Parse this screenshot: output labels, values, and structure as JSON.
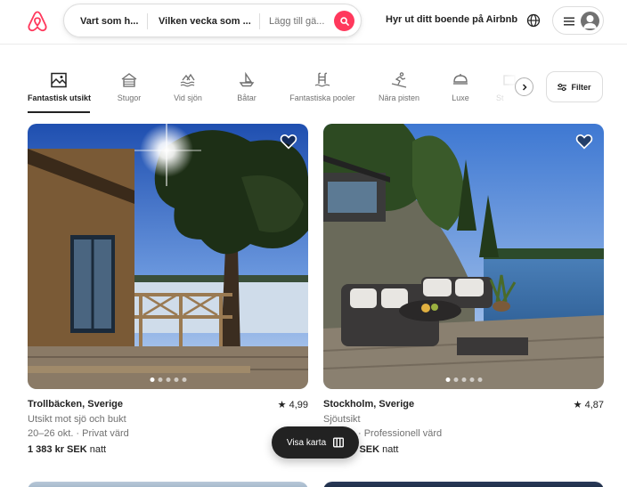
{
  "header": {
    "logo_icon": "airbnb-logo-icon",
    "search": {
      "where": "Vart som h...",
      "when": "Vilken vecka som ...",
      "who": "Lägg till gä...",
      "button_icon": "search-icon"
    },
    "host_link": "Hyr ut ditt boende på Airbnb",
    "globe_icon": "globe-icon",
    "menu_icon": "hamburger-icon",
    "avatar_icon": "user-avatar-icon"
  },
  "categories": {
    "items": [
      {
        "label": "Fantastisk utsikt",
        "icon": "view-icon",
        "active": true
      },
      {
        "label": "Stugor",
        "icon": "cabin-icon",
        "active": false
      },
      {
        "label": "Vid sjön",
        "icon": "lake-icon",
        "active": false
      },
      {
        "label": "Båtar",
        "icon": "boat-icon",
        "active": false
      },
      {
        "label": "Fantastiska pooler",
        "icon": "pool-icon",
        "active": false
      },
      {
        "label": "Nära pisten",
        "icon": "ski-icon",
        "active": false
      },
      {
        "label": "Luxe",
        "icon": "luxe-icon",
        "active": false
      },
      {
        "label": "St",
        "icon": "more-icon",
        "active": false
      }
    ],
    "next_icon": "chevron-right-icon",
    "filter_label": "Filter",
    "filter_icon": "sliders-icon"
  },
  "listings": [
    {
      "title": "Trollbäcken, Sverige",
      "rating": "4,99",
      "subtitle": "Utsikt mot sjö och bukt",
      "details": "20–26 okt. · Privat värd",
      "price": "1 383 kr SEK",
      "price_unit": "natt"
    },
    {
      "title": "Stockholm, Sverige",
      "rating": "4,87",
      "subtitle": "Sjöutsikt",
      "details": "· Professionell värd",
      "price": "kr SEK",
      "price_unit": "natt"
    }
  ],
  "map_button": {
    "label": "Visa karta",
    "icon": "map-icon"
  },
  "colors": {
    "brand": "#ff385c",
    "text": "#222222",
    "muted": "#717171"
  }
}
